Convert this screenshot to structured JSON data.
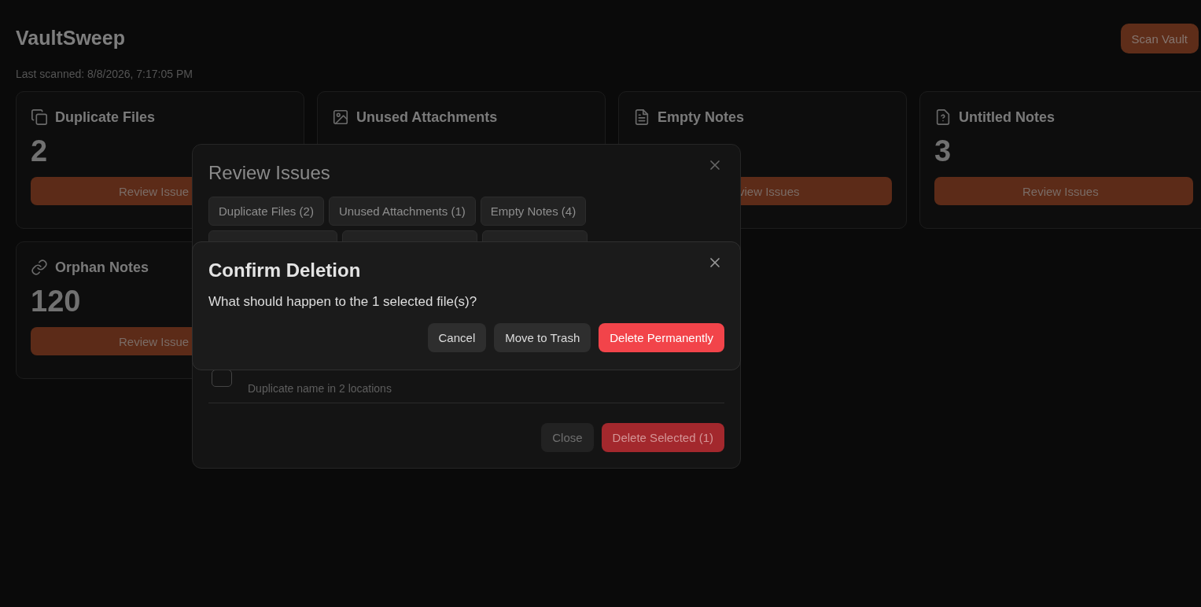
{
  "app": {
    "title": "VaultSweep",
    "last_scanned": "Last scanned: 8/8/2026, 7:17:05 PM",
    "scan_button": "Scan Vault"
  },
  "cards": [
    {
      "kind": "duplicate",
      "title": "Duplicate Files",
      "count": "2",
      "button": "Review Issue"
    },
    {
      "kind": "attachment",
      "title": "Unused Attachments"
    },
    {
      "kind": "empty",
      "title": "Empty Notes",
      "button": "view Issues"
    },
    {
      "kind": "untitled",
      "title": "Untitled Notes",
      "count": "3",
      "button": "Review Issues"
    },
    {
      "kind": "orphan",
      "title": "Orphan Notes",
      "count": "120",
      "button": "Review Issue"
    }
  ],
  "review_dialog": {
    "title": "Review Issues",
    "chips": [
      {
        "label": "Duplicate Files (2)",
        "selected": false
      },
      {
        "label": "Unused Attachments (1)",
        "selected": false
      },
      {
        "label": "Empty Notes (4)",
        "selected": false
      }
    ],
    "file_row": {
      "checked": false,
      "detail": "Duplicate name in 2 locations"
    },
    "buttons": [
      {
        "kind": "secondary",
        "label": "Close"
      },
      {
        "kind": "danger",
        "label": "Delete Selected (1)"
      }
    ]
  },
  "confirm_dialog": {
    "title": "Confirm Deletion",
    "message": "What should happen to the 1 selected file(s)?",
    "buttons": [
      {
        "kind": "secondary",
        "label": "Cancel"
      },
      {
        "kind": "secondary",
        "label": "Move to Trash"
      },
      {
        "kind": "danger",
        "label": "Delete Permanently"
      }
    ]
  }
}
